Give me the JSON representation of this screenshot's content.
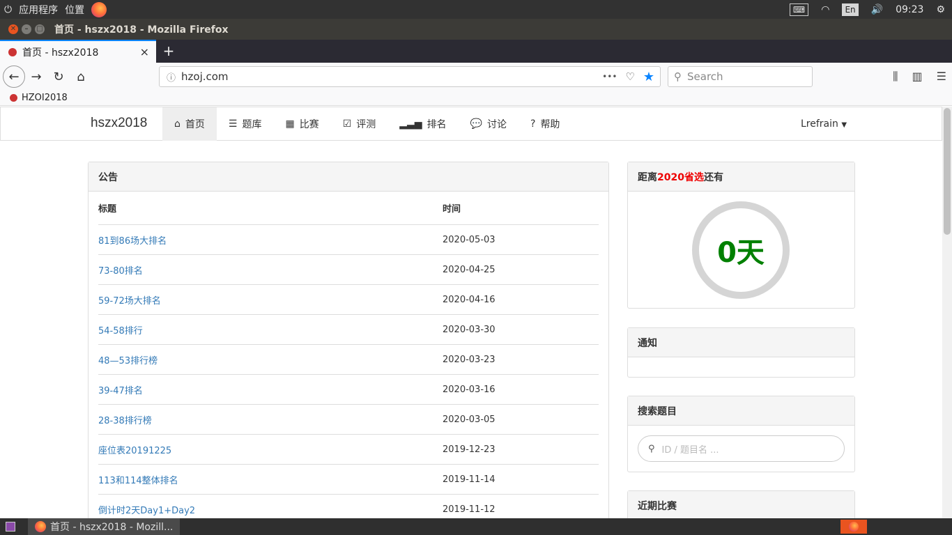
{
  "system": {
    "apps_menu": "应用程序",
    "places_menu": "位置",
    "lang": "En",
    "time": "09:23"
  },
  "window": {
    "title": "首页 - hszx2018 - Mozilla Firefox"
  },
  "tab": {
    "title": "首页 - hszx2018",
    "close": "×",
    "new_tab": "+"
  },
  "nav": {
    "url": "hzoj.com",
    "search_placeholder": "Search",
    "more": "•••"
  },
  "bookmarks": {
    "item": "HZOI2018"
  },
  "site": {
    "brand": "hszx2018",
    "menu": [
      "首页",
      "题库",
      "比赛",
      "评测",
      "排名",
      "讨论",
      "帮助"
    ],
    "user": "Lrefrain"
  },
  "announcements": {
    "title": "公告",
    "col_title": "标题",
    "col_time": "时间",
    "rows": [
      {
        "title": "81到86场大排名",
        "time": "2020-05-03"
      },
      {
        "title": "73-80排名",
        "time": "2020-04-25"
      },
      {
        "title": "59-72场大排名",
        "time": "2020-04-16"
      },
      {
        "title": "54-58排行",
        "time": "2020-03-30"
      },
      {
        "title": "48—53排行榜",
        "time": "2020-03-23"
      },
      {
        "title": "39-47排名",
        "time": "2020-03-16"
      },
      {
        "title": "28-38排行榜",
        "time": "2020-03-05"
      },
      {
        "title": "座位表20191225",
        "time": "2019-12-23"
      },
      {
        "title": "113和114整体排名",
        "time": "2019-11-14"
      },
      {
        "title": "倒计时2天Day1+Day2",
        "time": "2019-11-12"
      }
    ]
  },
  "countdown": {
    "prefix": "距离",
    "highlight": "2020省选",
    "suffix": "还有",
    "value": "0天"
  },
  "notice": {
    "title": "通知"
  },
  "search_problem": {
    "title": "搜索题目",
    "placeholder": "ID / 题目名 ..."
  },
  "recent_contests": {
    "title": "近期比赛"
  },
  "taskbar": {
    "item": "首页 - hszx2018 - Mozill..."
  },
  "colors": {
    "link": "#337ab7",
    "countdown": "#008000",
    "highlight": "#e00000"
  }
}
